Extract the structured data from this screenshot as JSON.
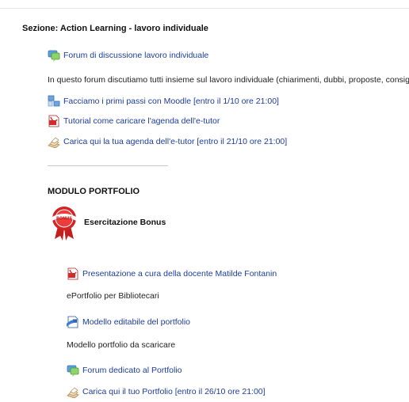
{
  "section": {
    "title": "Sezione: Action Learning - lavoro individuale"
  },
  "activities": [
    {
      "label": "Forum di discussione lavoro individuale",
      "icon": "forum-icon"
    },
    {
      "label": "In questo forum discutiamo tutti insieme sul lavoro individuale (chiarimenti, dubbi, proposte, consigli)"
    },
    {
      "label": "Facciamo i primi passi con Moodle [entro il 1/10 ore 21:00]",
      "icon": "assignment-icon"
    },
    {
      "label": "Tutorial come caricare l'agenda dell'e-tutor",
      "icon": "pdf-icon"
    },
    {
      "label": "Carica qui la tua agenda dell'e-tutor [entro il 21/10 ore 21:00]",
      "icon": "upload-icon"
    }
  ],
  "portfolio": {
    "heading": "MODULO PORTFOLIO",
    "bonus": {
      "badge_text": "BONUS",
      "title": "Esercitazione Bonus"
    },
    "items": [
      {
        "label": "Presentazione a cura della docente Matilde Fontanin",
        "icon": "pdf-icon"
      },
      {
        "label": "ePortfolio per Bibliotecari"
      },
      {
        "label": "Modello editabile del portfolio",
        "icon": "word-doc-icon"
      },
      {
        "label": "Modello portfolio da scaricare"
      },
      {
        "label": "Forum dedicato al Portfolio",
        "icon": "forum-icon"
      },
      {
        "label": "Carica qui il tuo Portfolio [entro il 26/10 ore 21:00]",
        "icon": "upload-icon"
      }
    ]
  },
  "colors": {
    "link": "#1c3d9c",
    "text": "#222222",
    "divider": "#c8c8c8"
  }
}
